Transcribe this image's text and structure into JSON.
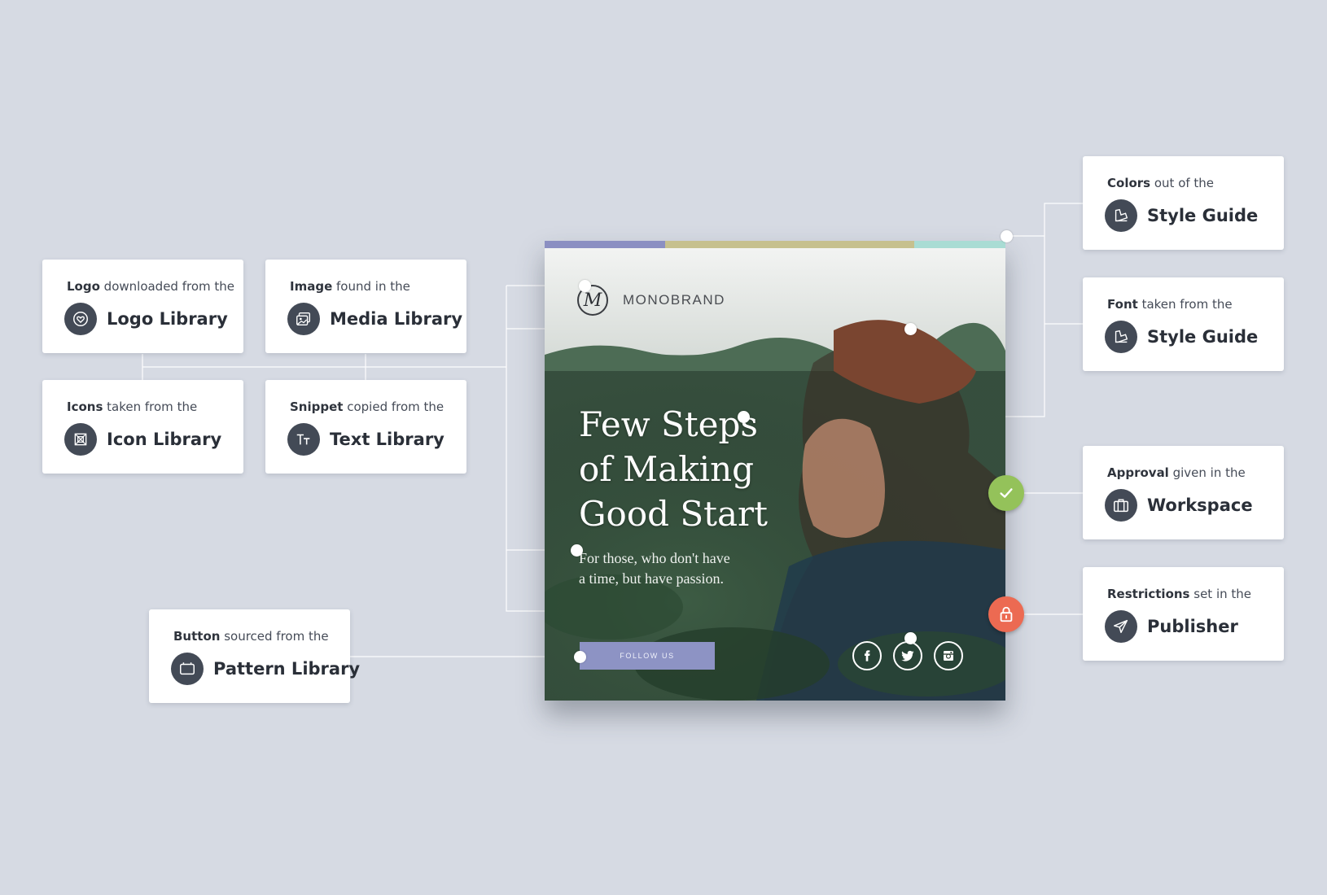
{
  "cards": {
    "logo": {
      "bold": "Logo",
      "rest": " downloaded from the",
      "title": "Logo Library",
      "icon": "heart-icon"
    },
    "media": {
      "bold": "Image",
      "rest": " found in the",
      "title": "Media Library",
      "icon": "image-icon"
    },
    "icons": {
      "bold": "Icons",
      "rest": " taken from the",
      "title": "Icon Library",
      "icon": "grid-icon"
    },
    "text": {
      "bold": "Snippet",
      "rest": " copied from the",
      "title": "Text Library",
      "icon": "text-icon"
    },
    "pattern": {
      "bold": "Button",
      "rest": " sourced from the",
      "title": "Pattern Library",
      "icon": "window-icon"
    },
    "colors": {
      "bold": "Colors",
      "rest": " out of the",
      "title": "Style Guide",
      "icon": "swatch-icon"
    },
    "font": {
      "bold": "Font",
      "rest": " taken from the",
      "title": "Style Guide",
      "icon": "swatch-icon"
    },
    "approval": {
      "bold": "Approval",
      "rest": " given in the",
      "title": "Workspace",
      "icon": "briefcase-icon"
    },
    "restrict": {
      "bold": "Restrictions",
      "rest": " set in the",
      "title": "Publisher",
      "icon": "paper-plane-icon"
    }
  },
  "poster": {
    "brand": "MONOBRAND",
    "logo_letter": "M",
    "headline": [
      "Few Steps",
      "of Making",
      "Good Start"
    ],
    "subline": [
      "For those, who don't have",
      "a time, but have passion."
    ],
    "button_label": "FOLLOW US",
    "social": [
      "facebook-icon",
      "twitter-icon",
      "instagram-icon"
    ],
    "palette": [
      "#8b8fc2",
      "#c6c08e",
      "#a9dcd4"
    ]
  },
  "colors": {
    "background": "#d6dae3",
    "approval_badge": "#94c25a",
    "restriction_badge": "#ec6a52",
    "icon_circle": "#434a56"
  }
}
